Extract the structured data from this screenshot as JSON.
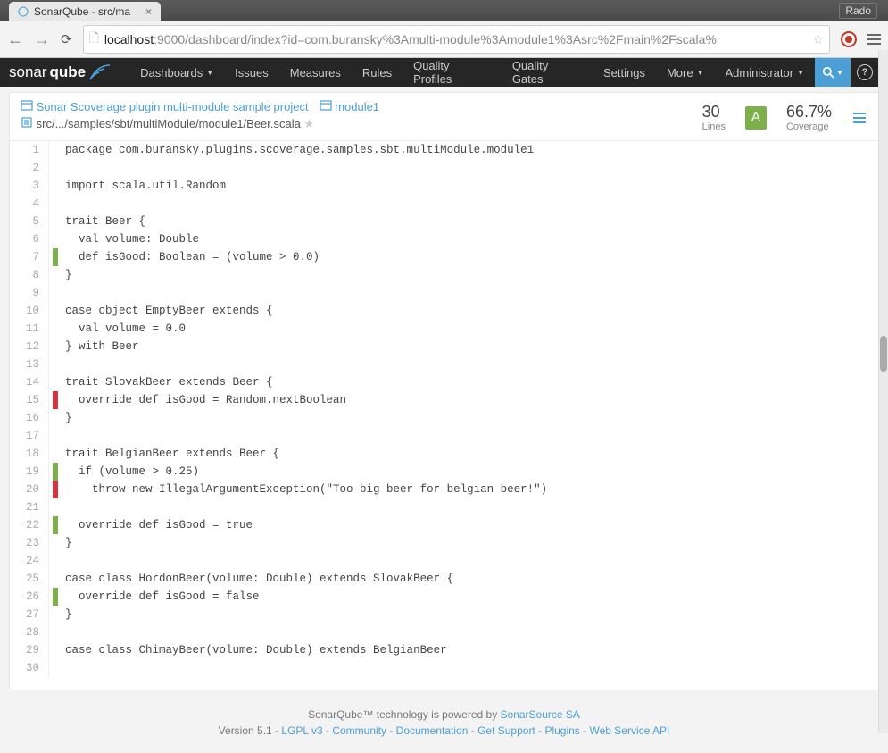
{
  "browser": {
    "tab_title": "SonarQube - src/ma",
    "user_badge": "Rado",
    "url_host": "localhost",
    "url_port": ":9000",
    "url_path": "/dashboard/index?id=com.buransky%3Amulti-module%3Amodule1%3Asrc%2Fmain%2Fscala%"
  },
  "nav": {
    "logo_a": "sonar",
    "logo_b": "qube",
    "items": [
      "Dashboards",
      "Issues",
      "Measures",
      "Rules",
      "Quality Profiles",
      "Quality Gates",
      "Settings",
      "More"
    ],
    "admin": "Administrator",
    "help": "?"
  },
  "breadcrumbs": {
    "project": "Sonar Scoverage plugin multi-module sample project",
    "module": "module1",
    "path": "src/.../samples/sbt/multiModule/module1/Beer.scala"
  },
  "metrics": {
    "lines_val": "30",
    "lines_label": "Lines",
    "rating": "A",
    "coverage_val": "66.7%",
    "coverage_label": "Coverage"
  },
  "chart_data": {
    "type": "table",
    "title": "Source line coverage",
    "lines": [
      {
        "n": 1,
        "cov": "",
        "text": "package com.buransky.plugins.scoverage.samples.sbt.multiModule.module1"
      },
      {
        "n": 2,
        "cov": "",
        "text": ""
      },
      {
        "n": 3,
        "cov": "",
        "text": "import scala.util.Random"
      },
      {
        "n": 4,
        "cov": "",
        "text": ""
      },
      {
        "n": 5,
        "cov": "",
        "text": "trait Beer {"
      },
      {
        "n": 6,
        "cov": "",
        "text": "  val volume: Double"
      },
      {
        "n": 7,
        "cov": "green",
        "text": "  def isGood: Boolean = (volume > 0.0)"
      },
      {
        "n": 8,
        "cov": "",
        "text": "}"
      },
      {
        "n": 9,
        "cov": "",
        "text": ""
      },
      {
        "n": 10,
        "cov": "",
        "text": "case object EmptyBeer extends {"
      },
      {
        "n": 11,
        "cov": "",
        "text": "  val volume = 0.0"
      },
      {
        "n": 12,
        "cov": "",
        "text": "} with Beer"
      },
      {
        "n": 13,
        "cov": "",
        "text": ""
      },
      {
        "n": 14,
        "cov": "",
        "text": "trait SlovakBeer extends Beer {"
      },
      {
        "n": 15,
        "cov": "red",
        "text": "  override def isGood = Random.nextBoolean"
      },
      {
        "n": 16,
        "cov": "",
        "text": "}"
      },
      {
        "n": 17,
        "cov": "",
        "text": ""
      },
      {
        "n": 18,
        "cov": "",
        "text": "trait BelgianBeer extends Beer {"
      },
      {
        "n": 19,
        "cov": "green",
        "text": "  if (volume > 0.25)"
      },
      {
        "n": 20,
        "cov": "red",
        "text": "    throw new IllegalArgumentException(\"Too big beer for belgian beer!\")"
      },
      {
        "n": 21,
        "cov": "",
        "text": ""
      },
      {
        "n": 22,
        "cov": "green",
        "text": "  override def isGood = true"
      },
      {
        "n": 23,
        "cov": "",
        "text": "}"
      },
      {
        "n": 24,
        "cov": "",
        "text": ""
      },
      {
        "n": 25,
        "cov": "",
        "text": "case class HordonBeer(volume: Double) extends SlovakBeer {"
      },
      {
        "n": 26,
        "cov": "green",
        "text": "  override def isGood = false"
      },
      {
        "n": 27,
        "cov": "",
        "text": "}"
      },
      {
        "n": 28,
        "cov": "",
        "text": ""
      },
      {
        "n": 29,
        "cov": "",
        "text": "case class ChimayBeer(volume: Double) extends BelgianBeer"
      },
      {
        "n": 30,
        "cov": "",
        "text": ""
      }
    ]
  },
  "footer": {
    "line1_a": "SonarQube™ technology is powered by ",
    "line1_b": "SonarSource SA",
    "version": "Version 5.1",
    "links": [
      "LGPL v3",
      "Community",
      "Documentation",
      "Get Support",
      "Plugins",
      "Web Service API"
    ]
  }
}
